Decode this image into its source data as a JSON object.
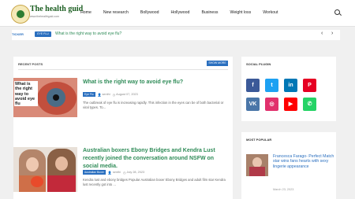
{
  "site": {
    "name": "The health guid",
    "tagline": "www.thehealthguid.com"
  },
  "nav": [
    "Home",
    "New research",
    "Bollywood",
    "Hollywood",
    "Business",
    "Weight loss",
    "Workout"
  ],
  "ticker": {
    "label": "TICKER",
    "badge": "EYE FLU",
    "text": "What is the right way to avoid eye flu?",
    "prev_glyph": "‹",
    "next_glyph": "›"
  },
  "recent": {
    "heading": "RECENT POSTS",
    "show_more": "SHOW MORE",
    "posts": [
      {
        "thumb_text": "What is the right way to avoid eye flu",
        "title": "What is the right way to avoid eye flu?",
        "tag": "Eye Flu",
        "author": "senthi",
        "date": "August 07, 2023",
        "excerpt": "The outbreak of eye flu is increasing rapidly. This infection in the eyes can be of both bacterial or viral types. To..."
      },
      {
        "title": "Australian boxers Ebony Bridges and Kendra Lust recently joined the conversation around NSFW on social media.",
        "tag": "Australian Boxer",
        "author": "senthi",
        "date": "July 28, 2023",
        "excerpt": "Kendra lust and ebony bridges Popular Australian boxer Ebony Bridges and adult film star Kendra lust recently got into ..."
      }
    ]
  },
  "sidebar": {
    "social_heading": "SOCIAL PLUGIN",
    "social": [
      {
        "name": "facebook-icon",
        "glyph": "f",
        "color": "#3b5998"
      },
      {
        "name": "twitter-icon",
        "glyph": "t",
        "color": "#1da1f2"
      },
      {
        "name": "linkedin-icon",
        "glyph": "in",
        "color": "#0077b5"
      },
      {
        "name": "pinterest-icon",
        "glyph": "P",
        "color": "#e60023"
      },
      {
        "name": "vk-icon",
        "glyph": "VK",
        "color": "#4a76a8"
      },
      {
        "name": "instagram-icon",
        "glyph": "◎",
        "color": "#e1306c"
      },
      {
        "name": "youtube-icon",
        "glyph": "▶",
        "color": "#ff0000"
      },
      {
        "name": "whatsapp-icon",
        "glyph": "✆",
        "color": "#25d366"
      }
    ],
    "popular_heading": "MOST POPULAR",
    "popular": {
      "title": "Francesca Farago- Perfect Match star wins fans hearts with sexy lingerie appearance",
      "date": "March 23, 2023"
    }
  },
  "colors": {
    "accent": "#2a6fbf",
    "title_green": "#2e8b57"
  }
}
